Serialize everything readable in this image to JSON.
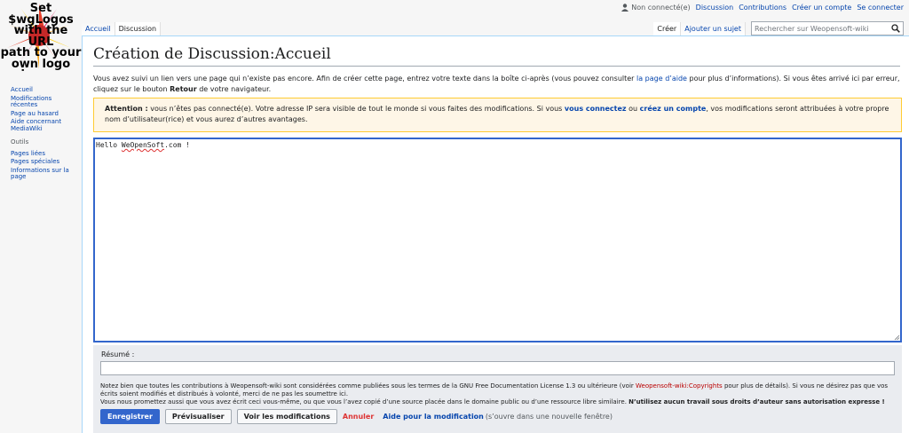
{
  "logo": {
    "lines": [
      "Set",
      "$wgLogos",
      "with the URL",
      "path to your",
      "own logo",
      "image"
    ]
  },
  "personal": {
    "user_status": "Non connecté(e)",
    "links": [
      "Discussion",
      "Contributions",
      "Créer un compte",
      "Se connecter"
    ]
  },
  "tabs": {
    "left": [
      {
        "label": "Accueil"
      },
      {
        "label": "Discussion"
      }
    ],
    "right": [
      {
        "label": "Créer"
      },
      {
        "label": "Ajouter un sujet"
      }
    ]
  },
  "search": {
    "placeholder": "Rechercher sur Weopensoft-wiki"
  },
  "sidebar": {
    "nav": [
      "Accueil",
      "Modifications récentes",
      "Page au hasard",
      "Aide concernant MediaWiki"
    ],
    "tools_heading": "Outils",
    "tools": [
      "Pages liées",
      "Pages spéciales",
      "Informations sur la page"
    ]
  },
  "page": {
    "title": "Création de Discussion:Accueil",
    "intro": {
      "part1": "Vous avez suivi un lien vers une page qui n’existe pas encore. Afin de créer cette page, entrez votre texte dans la boîte ci-après (vous pouvez consulter ",
      "help_link": "la page d’aide",
      "part2": " pour plus d’informations). Si vous êtes arrivé ici par erreur, cliquez sur le bouton ",
      "back_button": "Retour",
      "part3": " de votre navigateur."
    },
    "warning": {
      "label": "Attention :",
      "part1": " vous n’êtes pas connecté(e). Votre adresse IP sera visible de tout le monde si vous faites des modifications. Si vous ",
      "login_link": "vous connectez",
      "part2": " ou ",
      "create_link": "créez un compte",
      "part3": ", vos modifications seront attribuées à votre propre nom d’utilisateur(rice) et vous aurez d’autres avantages."
    },
    "editor": {
      "before": "Hello ",
      "misspelled": "WeOpenSoft",
      "after": ".com !"
    }
  },
  "edit_options": {
    "summary_label": "Résumé :",
    "notice": {
      "part1": "Notez bien que toutes les contributions à Weopensoft-wiki sont considérées comme publiées sous les termes de la GNU Free Documentation License 1.3 ou ultérieure (voir ",
      "copyright_link": "Weopensoft-wiki:Copyrights",
      "part2": " pour plus de détails). Si vous ne désirez pas que vos écrits soient modifiés et distribués à volonté, merci de ne pas les soumettre ici.",
      "part3": "Vous nous promettez aussi que vous avez écrit ceci vous-même, ou que vous l’avez copié d’une source placée dans le domaine public ou d’une ressource libre similaire. ",
      "bold": "N’utilisez aucun travail sous droits d’auteur sans autorisation expresse !"
    },
    "buttons": {
      "save": "Enregistrer",
      "preview": "Prévisualiser",
      "diff": "Voir les modifications",
      "cancel": "Annuler",
      "help": "Aide pour la modification",
      "help_note": "(s’ouvre dans une nouvelle fenêtre)"
    }
  }
}
